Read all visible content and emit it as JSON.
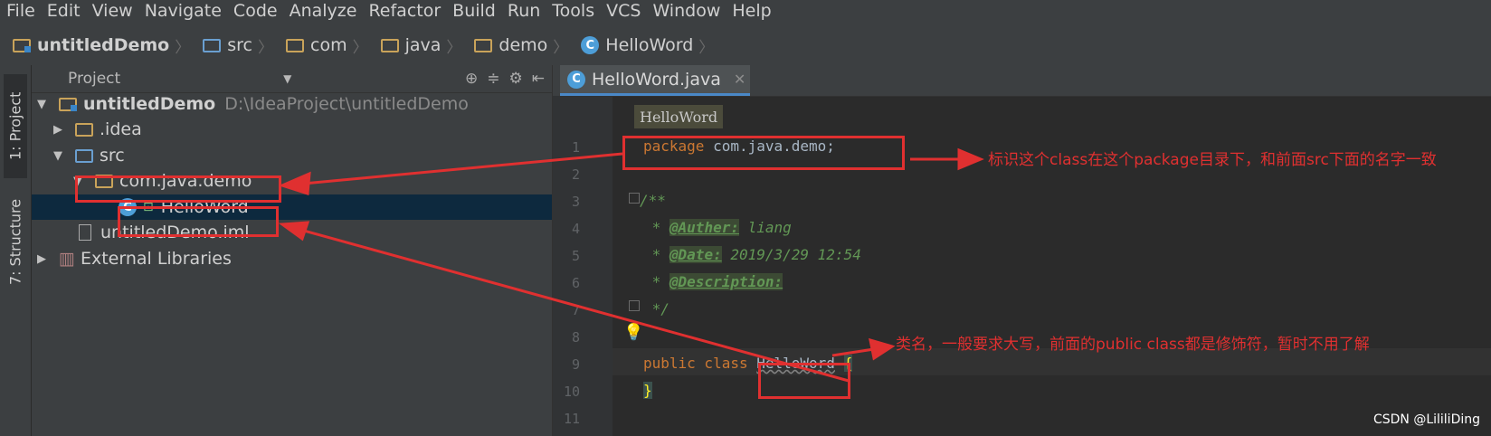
{
  "menu": [
    "File",
    "Edit",
    "View",
    "Navigate",
    "Code",
    "Analyze",
    "Refactor",
    "Build",
    "Run",
    "Tools",
    "VCS",
    "Window",
    "Help"
  ],
  "breadcrumb": [
    "untitledDemo",
    "src",
    "com",
    "java",
    "demo",
    "HelloWord"
  ],
  "sidebar": {
    "project_tab": "1: Project",
    "structure_tab": "7: Structure"
  },
  "project_panel": {
    "title": "Project",
    "tree": [
      {
        "label": "untitledDemo",
        "path": "D:\\IdeaProject\\untitledDemo"
      },
      {
        "label": ".idea"
      },
      {
        "label": "src"
      },
      {
        "label": "com.java.demo"
      },
      {
        "label": "HelloWord"
      },
      {
        "label": "untitledDemo.iml"
      },
      {
        "label": "External Libraries"
      }
    ]
  },
  "editor": {
    "tab": "HelloWord.java",
    "crumb_popup": "HelloWord",
    "line_numbers": [
      "1",
      "2",
      "3",
      "4",
      "5",
      "6",
      "7",
      "8",
      "9",
      "10",
      "11"
    ],
    "code": {
      "package_kw": "package",
      "package_name": " com.java.demo;",
      "c3": "/**",
      "c4_star": " * ",
      "c4_tag": "@Auther:",
      "c4_val": " liang",
      "c5_star": " * ",
      "c5_tag": "@Date:",
      "c5_val": " 2019/3/29 12:54",
      "c6_star": " * ",
      "c6_tag": "@Description:",
      "c7": " */",
      "public": "public",
      "class": " class ",
      "classname": "HelloWord",
      "brace_open": "{",
      "brace_close": "}"
    }
  },
  "annotations": {
    "note1": "标识这个class在这个package目录下，和前面src下面的名字一致",
    "note2": "类名，一般要求大写，前面的public class都是修饰符，暂时不用了解"
  },
  "watermark": "CSDN @LililiDing",
  "colors": {
    "annotation": "#e03030",
    "keyword": "#cc7832",
    "comment": "#629755"
  }
}
